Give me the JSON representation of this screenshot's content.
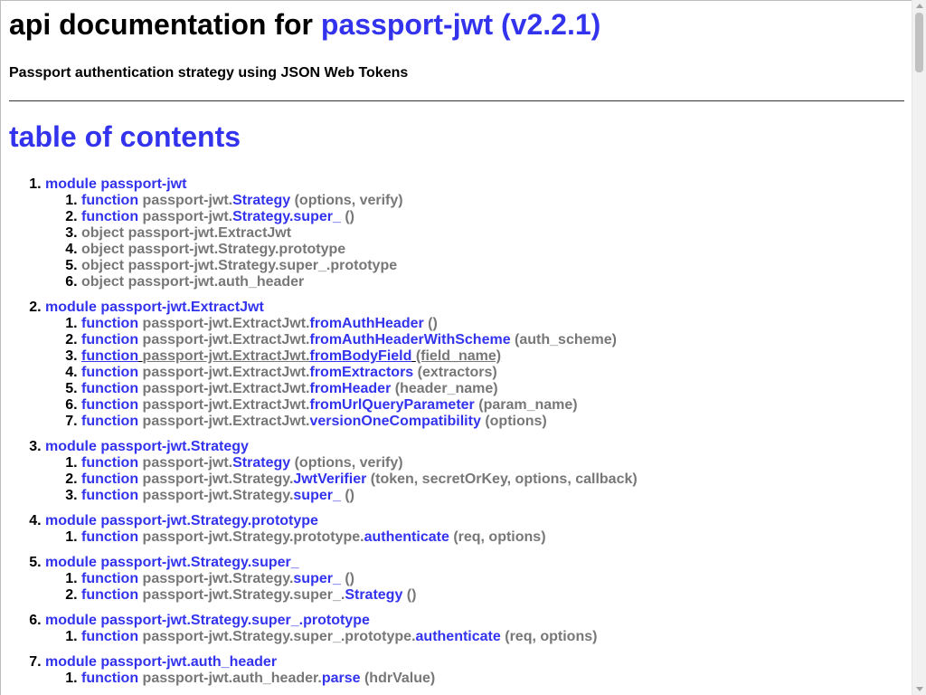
{
  "header": {
    "title_prefix": "api documentation for",
    "package": "passport-jwt (v2.2.1)",
    "subtitle": "Passport authentication strategy using JSON Web Tokens"
  },
  "toc_title": "table of contents",
  "modules": [
    {
      "label": "module passport-jwt",
      "items": [
        {
          "kind": "function",
          "prefix": "passport-jwt.",
          "name": "Strategy",
          "args": "(options, verify)"
        },
        {
          "kind": "function",
          "prefix": "passport-jwt.",
          "name": "Strategy.super_",
          "args": "()"
        },
        {
          "kind": "object",
          "prefix": "passport-jwt.ExtractJwt",
          "name": "",
          "args": ""
        },
        {
          "kind": "object",
          "prefix": "passport-jwt.Strategy.prototype",
          "name": "",
          "args": ""
        },
        {
          "kind": "object",
          "prefix": "passport-jwt.Strategy.super_.prototype",
          "name": "",
          "args": ""
        },
        {
          "kind": "object",
          "prefix": "passport-jwt.auth_header",
          "name": "",
          "args": ""
        }
      ]
    },
    {
      "label": "module passport-jwt.ExtractJwt",
      "items": [
        {
          "kind": "function",
          "prefix": "passport-jwt.ExtractJwt.",
          "name": "fromAuthHeader",
          "args": "()"
        },
        {
          "kind": "function",
          "prefix": "passport-jwt.ExtractJwt.",
          "name": "fromAuthHeaderWithScheme",
          "args": "(auth_scheme)"
        },
        {
          "kind": "function",
          "prefix": "passport-jwt.ExtractJwt.",
          "name": "fromBodyField",
          "args": "(field_name)",
          "hovered": true
        },
        {
          "kind": "function",
          "prefix": "passport-jwt.ExtractJwt.",
          "name": "fromExtractors",
          "args": "(extractors)"
        },
        {
          "kind": "function",
          "prefix": "passport-jwt.ExtractJwt.",
          "name": "fromHeader",
          "args": "(header_name)"
        },
        {
          "kind": "function",
          "prefix": "passport-jwt.ExtractJwt.",
          "name": "fromUrlQueryParameter",
          "args": "(param_name)"
        },
        {
          "kind": "function",
          "prefix": "passport-jwt.ExtractJwt.",
          "name": "versionOneCompatibility",
          "args": "(options)"
        }
      ]
    },
    {
      "label": "module passport-jwt.Strategy",
      "items": [
        {
          "kind": "function",
          "prefix": "passport-jwt.",
          "name": "Strategy",
          "args": "(options, verify)"
        },
        {
          "kind": "function",
          "prefix": "passport-jwt.Strategy.",
          "name": "JwtVerifier",
          "args": "(token, secretOrKey, options, callback)"
        },
        {
          "kind": "function",
          "prefix": "passport-jwt.Strategy.",
          "name": "super_",
          "args": "()"
        }
      ]
    },
    {
      "label": "module passport-jwt.Strategy.prototype",
      "items": [
        {
          "kind": "function",
          "prefix": "passport-jwt.Strategy.prototype.",
          "name": "authenticate",
          "args": "(req, options)"
        }
      ]
    },
    {
      "label": "module passport-jwt.Strategy.super_",
      "items": [
        {
          "kind": "function",
          "prefix": "passport-jwt.Strategy.",
          "name": "super_",
          "args": "()"
        },
        {
          "kind": "function",
          "prefix": "passport-jwt.Strategy.super_.",
          "name": "Strategy",
          "args": "()"
        }
      ]
    },
    {
      "label": "module passport-jwt.Strategy.super_.prototype",
      "items": [
        {
          "kind": "function",
          "prefix": "passport-jwt.Strategy.super_.prototype.",
          "name": "authenticate",
          "args": "(req, options)"
        }
      ]
    },
    {
      "label": "module passport-jwt.auth_header",
      "items": [
        {
          "kind": "function",
          "prefix": "passport-jwt.auth_header.",
          "name": "parse",
          "args": "(hdrValue)"
        }
      ]
    }
  ],
  "colors": {
    "link": "#3333ee",
    "muted": "#777777",
    "text": "#000000"
  }
}
